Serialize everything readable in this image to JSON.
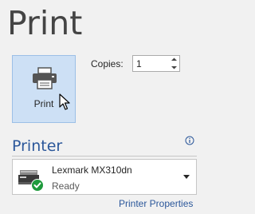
{
  "page": {
    "title": "Print"
  },
  "print_button": {
    "label": "Print",
    "icon": "printer-icon"
  },
  "copies": {
    "label": "Copies:",
    "value": "1"
  },
  "printer_section": {
    "heading": "Printer",
    "info_icon": "info-icon"
  },
  "printer_select": {
    "name": "Lexmark MX310dn",
    "status": "Ready",
    "status_icon": "check-circle-icon"
  },
  "links": {
    "printer_properties": "Printer Properties"
  },
  "colors": {
    "background": "#f1f1f1",
    "accent": "#2b579a",
    "button_selected_fill": "#cde0f5",
    "button_selected_border": "#9cbfe6",
    "ready_green": "#1e9a3c"
  }
}
